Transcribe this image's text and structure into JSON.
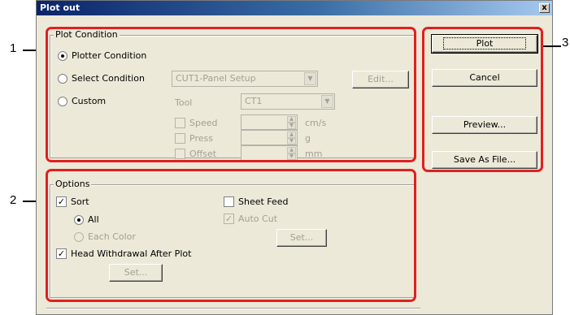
{
  "window": {
    "title": "Plot out",
    "close_glyph": "x"
  },
  "plot_condition": {
    "group_label": "Plot Condition",
    "plotter_condition": "Plotter Condition",
    "select_condition": "Select Condition",
    "custom": "Custom",
    "select_combo_value": "CUT1-Panel Setup",
    "edit_button": "Edit...",
    "tool_label": "Tool",
    "tool_combo_value": "CT1",
    "speed_label": "Speed",
    "speed_unit": "cm/s",
    "press_label": "Press",
    "press_unit": "g",
    "offset_label": "Offset",
    "offset_unit": "mm"
  },
  "options": {
    "group_label": "Options",
    "sort": "Sort",
    "all": "All",
    "each_color": "Each Color",
    "sheet_feed": "Sheet Feed",
    "auto_cut": "Auto Cut",
    "set_button_1": "Set...",
    "head_withdrawal": "Head Withdrawal After Plot",
    "set_button_2": "Set..."
  },
  "buttons": {
    "plot": "Plot",
    "cancel": "Cancel",
    "preview": "Preview...",
    "save_as_file": "Save As File..."
  },
  "callouts": {
    "one": "1",
    "two": "2",
    "three": "3"
  },
  "colors": {
    "highlight": "#e02020",
    "titlebar": "#0a246a",
    "dialog_bg": "#ece9d8"
  },
  "state": {
    "selected_condition": "Plotter Condition",
    "sort_checked": true,
    "sort_mode": "All",
    "sheet_feed_checked": false,
    "auto_cut_checked": true,
    "head_withdrawal_checked": true
  }
}
